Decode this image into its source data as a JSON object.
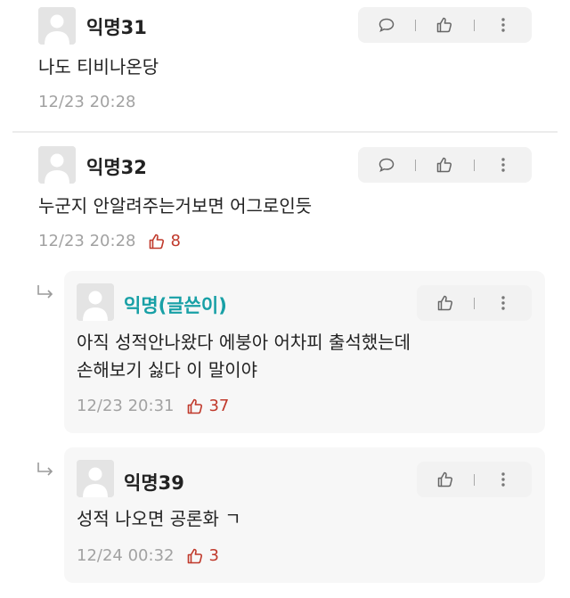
{
  "comments": [
    {
      "name": "익명31",
      "text": "나도 티비나온당",
      "time": "12/23 20:28",
      "likes": null
    },
    {
      "name": "익명32",
      "text": "누군지 안알려주는거보면 어그로인듯",
      "time": "12/23 20:28",
      "likes": "8"
    }
  ],
  "replies": [
    {
      "name": "익명(글쓴이)",
      "text_lines": [
        "아직 성적안나왔다 에붕아 어차피 출석했는데",
        "손해보기 싫다 이 말이야"
      ],
      "time": "12/23 20:31",
      "likes": "37"
    },
    {
      "name": "익명39",
      "text_lines": [
        "성적 나오면 공론화 ㄱ"
      ],
      "time": "12/24 00:32",
      "likes": "3"
    }
  ],
  "icons": {
    "reply": "speech-bubble-icon",
    "like": "thumbs-up-icon",
    "more": "vertical-ellipsis-icon",
    "avatar": "default-user-avatar",
    "reply_indicator": "reply-arrow-icon"
  },
  "colors": {
    "author_name": "#18a0a6",
    "like_count": "#c0392b",
    "timestamp": "#a2a2a2",
    "reply_card_bg": "#f7f7f7",
    "action_bar_bg": "#f2f2f2"
  }
}
